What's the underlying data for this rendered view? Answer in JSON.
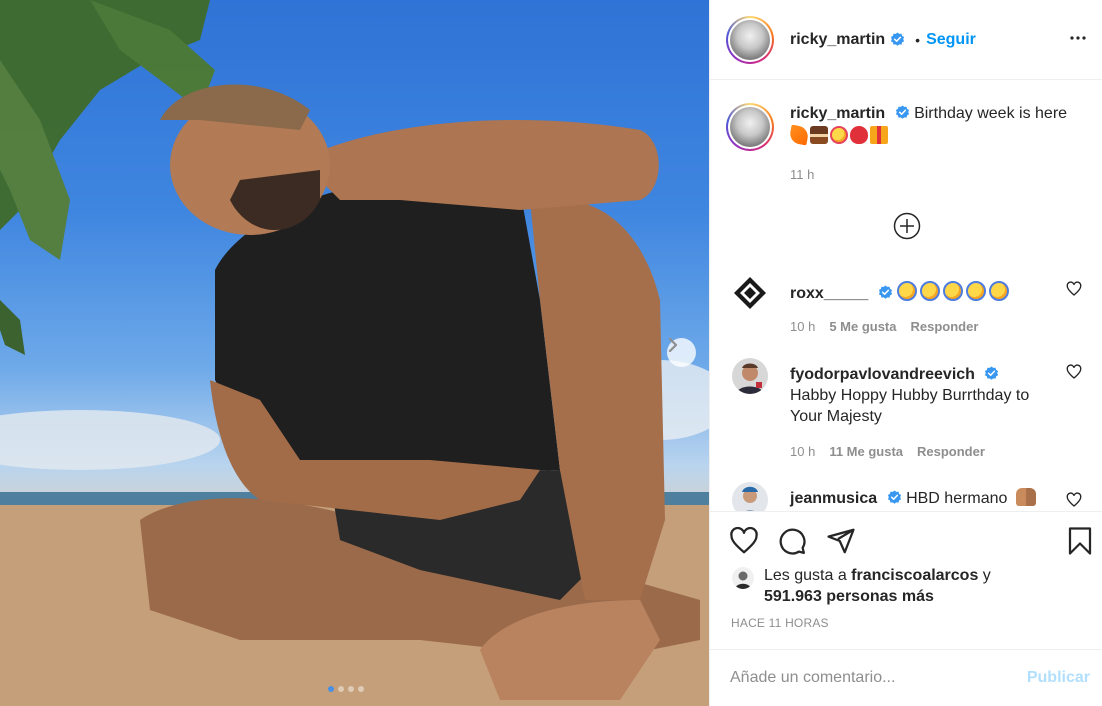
{
  "post": {
    "image_alt": "Hombre sentado en la playa",
    "carousel": {
      "total_slides": 4,
      "current_slide": 1
    }
  },
  "header": {
    "username": "ricky_martin",
    "separator": "•",
    "follow_label": "Seguir"
  },
  "caption": {
    "username": "ricky_martin",
    "text": "Birthday week is here",
    "emojis": [
      "carrot",
      "cake",
      "party-face",
      "balloon",
      "gift"
    ],
    "time": "11 h"
  },
  "comments": [
    {
      "username": "roxx_____",
      "verified": true,
      "text": "",
      "emoji_count": 5,
      "time": "10 h",
      "likes": "5 Me gusta",
      "reply": "Responder"
    },
    {
      "username": "fyodorpavlovandreevich",
      "verified": true,
      "text": "Habby Hoppy Hubby Burrthday to Your Majesty",
      "time": "10 h",
      "likes": "11 Me gusta",
      "reply": "Responder"
    },
    {
      "username": "jeanmusica",
      "verified": true,
      "text": "HBD hermano",
      "time": "",
      "likes": "",
      "reply": ""
    }
  ],
  "likes_summary": {
    "prefix": "Les gusta a ",
    "user": "franciscoalarcos",
    "connector": " y",
    "others": "591.963 personas más"
  },
  "timestamp": "HACE 11 HORAS",
  "add_comment": {
    "placeholder": "Añade un comentario...",
    "publish_label": "Publicar"
  },
  "colors": {
    "accent": "#0095f6",
    "publish_disabled": "#b2dffc",
    "verified": "#3897f0",
    "secondary_text": "#8e8e8e"
  }
}
